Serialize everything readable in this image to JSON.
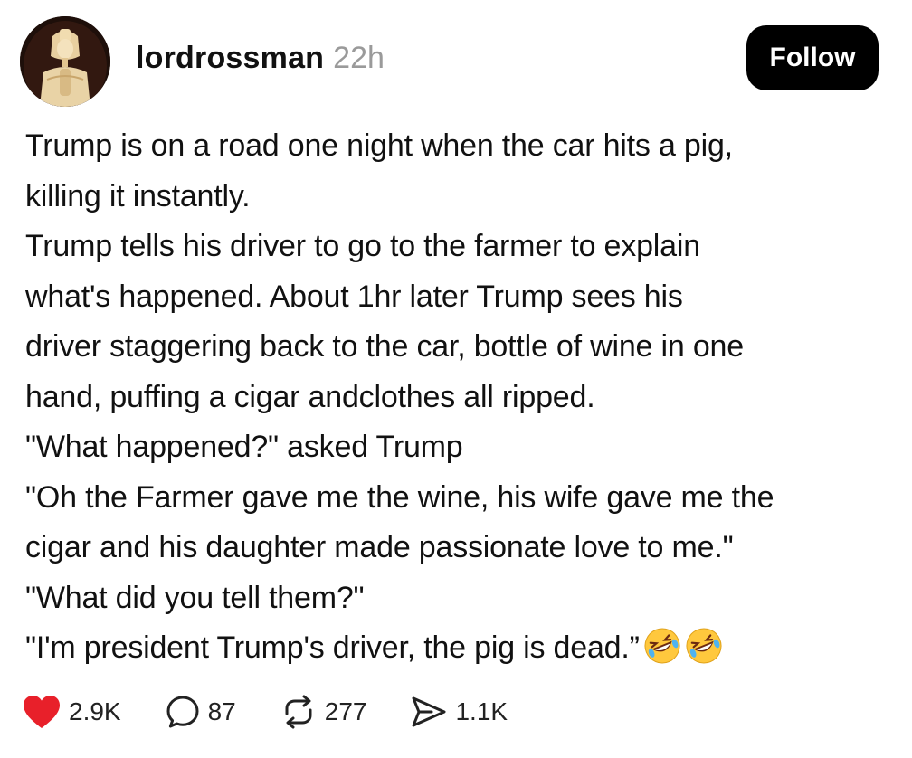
{
  "user": {
    "username": "lordrossman",
    "timestamp": "22h"
  },
  "follow_label": "Follow",
  "post": {
    "lines": [
      "Trump is on a road one night when the car hits a pig,",
      "killing it instantly.",
      "Trump tells his driver to go to the farmer to explain",
      "what's happened. About 1hr later Trump sees his",
      "driver staggering back to the car, bottle of wine in one",
      "hand, puffing a cigar andclothes all ripped.",
      "\"What happened?\" asked Trump",
      "\"Oh the Farmer gave me the wine, his wife gave me the",
      "cigar and his daughter made passionate love to me.\"",
      "\"What did you tell them?\"",
      "\"I'm president Trump's driver, the pig is dead.”"
    ],
    "emoji_names": [
      "rolling-on-floor-laughing-emoji",
      "rolling-on-floor-laughing-emoji"
    ]
  },
  "actions": {
    "likes": "2.9K",
    "replies": "87",
    "reposts": "277",
    "shares": "1.1K"
  },
  "colors": {
    "like": "#e8202a",
    "follow_bg": "#000000",
    "timestamp": "#9a9a9a"
  }
}
